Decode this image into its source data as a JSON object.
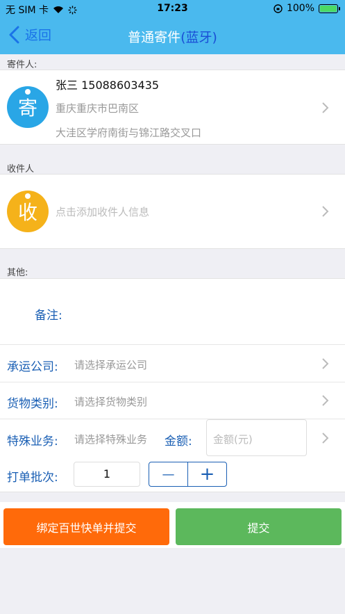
{
  "status": {
    "carrier": "无 SIM 卡",
    "time": "17:23",
    "battery": "100%"
  },
  "nav": {
    "back_label": "返回",
    "title_main": "普通寄件",
    "title_suffix": "(蓝牙)"
  },
  "sender": {
    "section_label": "寄件人:",
    "avatar_char": "寄",
    "name_phone": "张三  15088603435",
    "district": "重庆重庆市巴南区",
    "address": "大洼区学府南街与锦江路交叉口"
  },
  "receiver": {
    "section_label": "收件人",
    "avatar_char": "收",
    "placeholder": "点击添加收件人信息"
  },
  "other": {
    "section_label": "其他:",
    "remark_label": "备注:",
    "carrier_label": "承运公司:",
    "carrier_placeholder": "请选择承运公司",
    "cargo_label": "货物类别:",
    "cargo_placeholder": "请选择货物类别",
    "special_label": "特殊业务:",
    "special_placeholder": "请选择特殊业务",
    "amount_label": "金额:",
    "amount_placeholder": "金额(元)",
    "batch_label": "打单批次:",
    "batch_value": "1",
    "minus": "—",
    "plus": "+"
  },
  "buttons": {
    "bind_submit": "绑定百世快单并提交",
    "submit": "提交"
  },
  "colors": {
    "header": "#4ab9ee",
    "sender_avatar": "#29a6e6",
    "receiver_avatar": "#f5b21a",
    "orange": "#ff6a0a",
    "green": "#5cb85c"
  }
}
